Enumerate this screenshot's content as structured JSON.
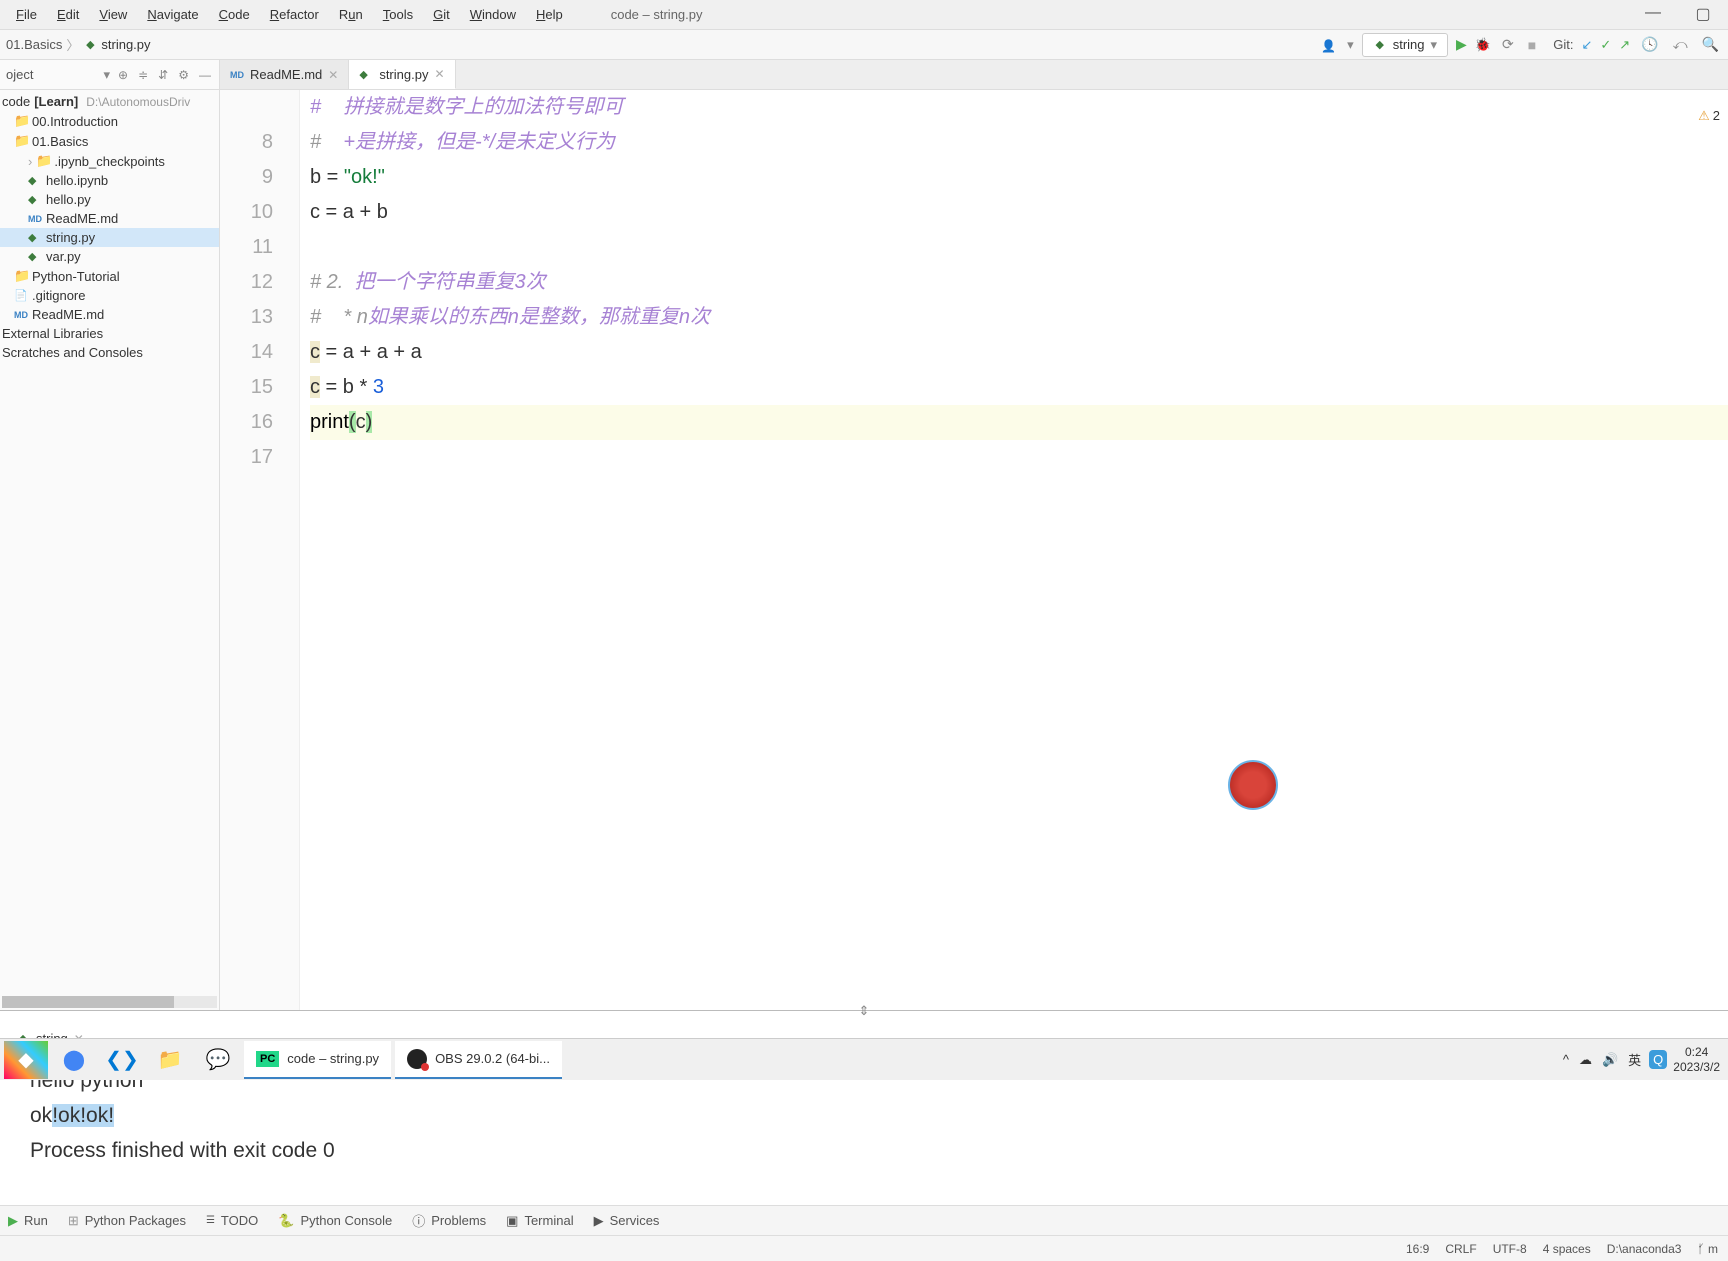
{
  "window": {
    "title": "code – string.py",
    "menu": [
      "File",
      "Edit",
      "View",
      "Navigate",
      "Code",
      "Refactor",
      "Run",
      "Tools",
      "Git",
      "Window",
      "Help"
    ]
  },
  "breadcrumb": {
    "folder": "01.Basics",
    "file": "string.py"
  },
  "run_config": {
    "name": "string"
  },
  "git": {
    "label": "Git:"
  },
  "sidebar": {
    "title": "oject",
    "root_name": "code",
    "root_tag": "[Learn]",
    "root_path": "D:\\AutonomousDriv",
    "items": [
      {
        "label": "00.Introduction",
        "type": "folder",
        "indent": 1
      },
      {
        "label": "01.Basics",
        "type": "folder",
        "indent": 1
      },
      {
        "label": ".ipynb_checkpoints",
        "type": "folder",
        "indent": 2
      },
      {
        "label": "hello.ipynb",
        "type": "py",
        "indent": 2
      },
      {
        "label": "hello.py",
        "type": "py",
        "indent": 2
      },
      {
        "label": "ReadME.md",
        "type": "md",
        "indent": 2
      },
      {
        "label": "string.py",
        "type": "py",
        "indent": 2,
        "selected": true
      },
      {
        "label": "var.py",
        "type": "py",
        "indent": 2
      },
      {
        "label": "Python-Tutorial",
        "type": "folder",
        "indent": 1
      },
      {
        "label": ".gitignore",
        "type": "file",
        "indent": 1
      },
      {
        "label": "ReadME.md",
        "type": "md",
        "indent": 1
      }
    ],
    "external": "External Libraries",
    "scratches": "Scratches and Consoles"
  },
  "editor": {
    "tabs": [
      {
        "label": "ReadME.md",
        "icon": "md",
        "active": false
      },
      {
        "label": "string.py",
        "icon": "py",
        "active": true
      }
    ],
    "gutter": [
      "",
      "8",
      "9",
      "10",
      "11",
      "12",
      "13",
      "14",
      "15",
      "16",
      "17"
    ],
    "lines": {
      "l7": "#    拼接就是数字上的加法符号即可",
      "l8a": "#    ",
      "l8b": "+是拼接，但是-*/是未定义行为",
      "l9a": "b = ",
      "l9b": "\"ok!\"",
      "l10": "c = a + b",
      "l11": "",
      "l12a": "# 2.  ",
      "l12b": "把一个字符串重复3次",
      "l13a": "#    * n",
      "l13b": "如果乘以的东西n是整数，那就重复n次",
      "l14a": "c",
      "l14b": " = a + a + a",
      "l15a": "c",
      "l15b": " = b * ",
      "l15c": "3",
      "l16a": "print",
      "l16b": "(",
      "l16c": "c",
      "l16d": ")",
      "l17": ""
    },
    "warn_count": "2"
  },
  "run_panel": {
    "tab_label": "string",
    "output": {
      "line1": "hello python",
      "line2a": "ok",
      "line2b": "!ok!ok!",
      "line3": "",
      "line4": "Process finished with exit code 0"
    }
  },
  "tool_windows": {
    "run": "Run",
    "packages": "Python Packages",
    "todo": "TODO",
    "console": "Python Console",
    "problems": "Problems",
    "terminal": "Terminal",
    "services": "Services"
  },
  "status_bar": {
    "position": "16:9",
    "line_sep": "CRLF",
    "encoding": "UTF-8",
    "indent": "4 spaces",
    "interpreter": "D:\\anaconda3",
    "branch": "m"
  },
  "taskbar": {
    "app1": "code – string.py",
    "app2": "OBS 29.0.2 (64-bi...",
    "ime": "英",
    "time": "0:24",
    "date": "2023/3/2"
  }
}
